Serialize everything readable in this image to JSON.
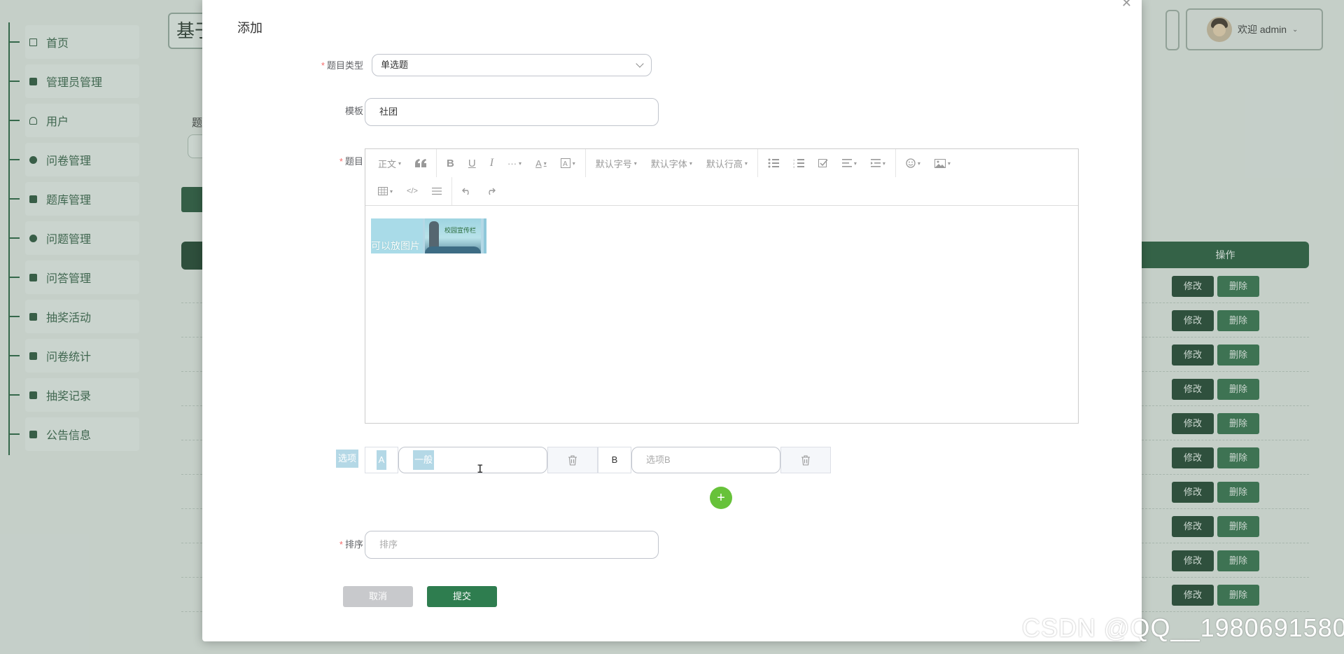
{
  "sidebar": {
    "items": [
      {
        "label": "首页",
        "icon": "home-icon"
      },
      {
        "label": "管理员管理",
        "icon": "book-icon"
      },
      {
        "label": "用户",
        "icon": "user-icon"
      },
      {
        "label": "问卷管理",
        "icon": "gear-icon"
      },
      {
        "label": "题库管理",
        "icon": "database-icon"
      },
      {
        "label": "问题管理",
        "icon": "compass-icon"
      },
      {
        "label": "问答管理",
        "icon": "book-icon"
      },
      {
        "label": "抽奖活动",
        "icon": "server-icon"
      },
      {
        "label": "问卷统计",
        "icon": "document-icon"
      },
      {
        "label": "抽奖记录",
        "icon": "bank-icon"
      },
      {
        "label": "公告信息",
        "icon": "grid-icon"
      }
    ]
  },
  "header": {
    "title_partial": "基于",
    "user_greeting": "欢迎 admin"
  },
  "background_table": {
    "header_operation": "操作",
    "filter_label_partial": "题",
    "row_actions": {
      "edit": "修改",
      "delete": "删除"
    },
    "row_count": 10
  },
  "dialog": {
    "title": "添加",
    "fields": {
      "question_type": {
        "label": "题目类型",
        "value": "单选题"
      },
      "template": {
        "label": "模板",
        "value": "社团"
      },
      "question": {
        "label": "题目"
      },
      "options": {
        "label": "选项",
        "items": [
          {
            "letter": "A",
            "value": "一般",
            "placeholder": ""
          },
          {
            "letter": "B",
            "value": "",
            "placeholder": "选项B"
          }
        ]
      },
      "sort": {
        "label": "排序",
        "placeholder": "排序"
      }
    },
    "editor": {
      "toolbar_row1": [
        "正文",
        "默认字号",
        "默认字体",
        "默认行高"
      ],
      "image_caption": "可以放图片",
      "image_logo_text": "校园宣传栏"
    },
    "buttons": {
      "cancel": "取消",
      "submit": "提交"
    }
  },
  "watermark": "CSDN @QQ__1980691580"
}
